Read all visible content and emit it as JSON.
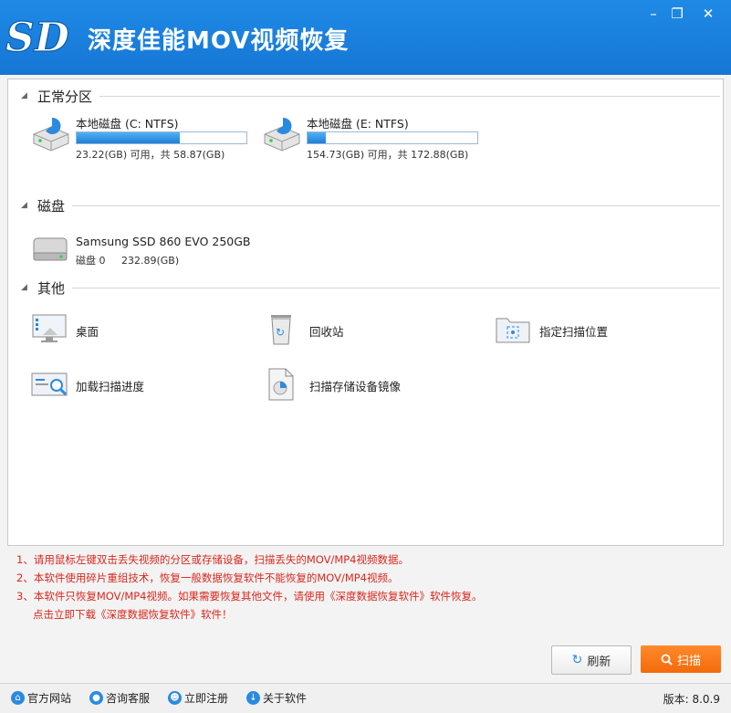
{
  "app": {
    "title": "深度佳能MOV视频恢复",
    "logo_text": "SD"
  },
  "window": {
    "minimize_icon": "minimize-icon",
    "restore_icon": "restore-icon",
    "close_icon": "close-icon"
  },
  "sections": {
    "normal_partitions": {
      "label": "正常分区"
    },
    "disks": {
      "label": "磁盘"
    },
    "other": {
      "label": "其他"
    }
  },
  "partitions": [
    {
      "name": "本地磁盘 (C: NTFS)",
      "usage": "23.22(GB) 可用，共 58.87(GB)",
      "used_fraction": 0.605
    },
    {
      "name": "本地磁盘 (E: NTFS)",
      "usage": "154.73(GB) 可用，共 172.88(GB)",
      "used_fraction": 0.105
    }
  ],
  "disk": {
    "name": "Samsung SSD 860 EVO 250GB",
    "info": "磁盘 0     232.89(GB)"
  },
  "others": [
    {
      "label": "桌面",
      "icon": "desktop-icon"
    },
    {
      "label": "回收站",
      "icon": "recycle-bin-icon"
    },
    {
      "label": "指定扫描位置",
      "icon": "scan-location-icon"
    },
    {
      "label": "加载扫描进度",
      "icon": "load-progress-icon"
    },
    {
      "label": "扫描存储设备镜像",
      "icon": "disk-image-icon"
    }
  ],
  "tips": [
    "1、请用鼠标左键双击丢失视频的分区或存储设备，扫描丢失的MOV/MP4视频数据。",
    "2、本软件使用碎片重组技术，恢复一般数据恢复软件不能恢复的MOV/MP4视频。",
    "3、本软件只恢复MOV/MP4视频。如果需要恢复其他文件，请使用《深度数据恢复软件》软件恢复。",
    "点击立即下载《深度数据恢复软件》软件！"
  ],
  "buttons": {
    "refresh": "刷新",
    "scan": "扫描"
  },
  "status": {
    "links": [
      "官方网站",
      "咨询客服",
      "立即注册",
      "关于软件"
    ],
    "version": "版本: 8.0.9"
  },
  "colors": {
    "title_bar": "#1a7fdc",
    "accent_orange": "#f36a0b",
    "tip_red": "#d8281e",
    "progress": "#2a8ae0"
  }
}
